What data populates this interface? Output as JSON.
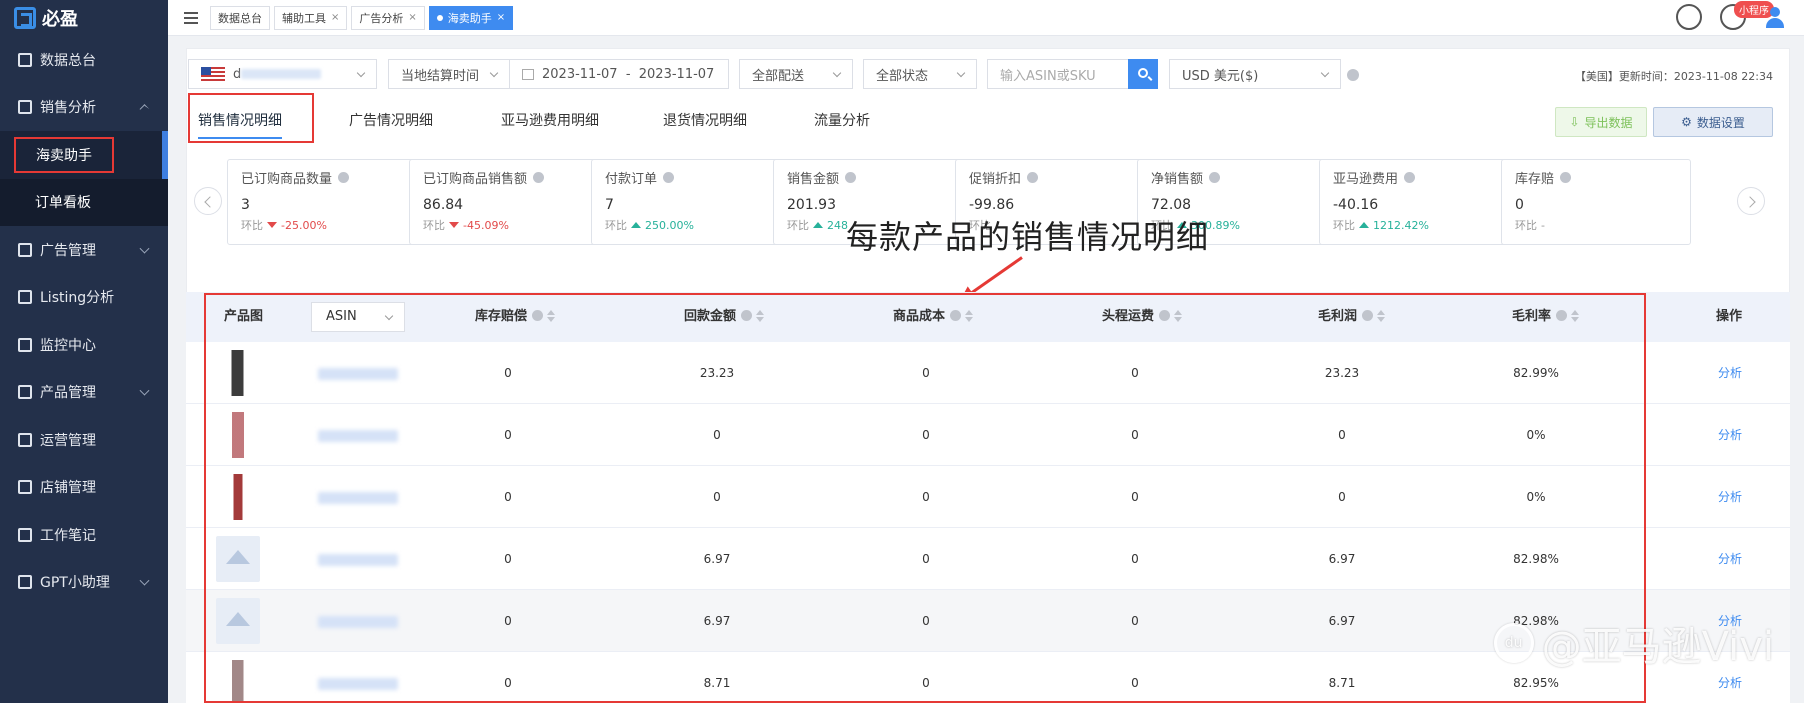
{
  "brand": {
    "name": "必盈"
  },
  "sidebar": {
    "items": [
      {
        "label": "数据总台",
        "icon": "monitor-icon"
      },
      {
        "label": "销售分析",
        "icon": "chart-icon",
        "expanded": true
      },
      {
        "label": "海卖助手",
        "sub": true,
        "active": true
      },
      {
        "label": "订单看板",
        "sub": true
      },
      {
        "label": "广告管理",
        "icon": "ad-icon"
      },
      {
        "label": "Listing分析",
        "icon": "bar-chart-icon"
      },
      {
        "label": "监控中心",
        "icon": "monitor-icon"
      },
      {
        "label": "产品管理",
        "icon": "grid-icon"
      },
      {
        "label": "运营管理",
        "icon": "user-icon"
      },
      {
        "label": "店铺管理",
        "icon": "store-icon"
      },
      {
        "label": "工作笔记",
        "icon": "note-icon"
      },
      {
        "label": "GPT小助理",
        "icon": "bot-icon"
      }
    ]
  },
  "topbar": {
    "tabs": [
      {
        "label": "数据总台"
      },
      {
        "label": "辅助工具"
      },
      {
        "label": "广告分析"
      },
      {
        "label": "海卖助手",
        "active": true
      }
    ],
    "mini_program": "小程序"
  },
  "filters": {
    "store": "d",
    "settlement": "当地结算时间",
    "date_range": "2023-11-07  -  2023-11-07",
    "shipping": "全部配送",
    "status": "全部状态",
    "asin_placeholder": "输入ASIN或SKU",
    "currency": "USD 美元($)",
    "update_info": "【美国】更新时间：2023-11-08 22:34"
  },
  "tabs": [
    {
      "label": "销售情况明细",
      "active": true
    },
    {
      "label": "广告情况明细"
    },
    {
      "label": "亚马逊费用明细"
    },
    {
      "label": "退货情况明细"
    },
    {
      "label": "流量分析"
    }
  ],
  "buttons": {
    "export": "导出数据",
    "settings": "数据设置"
  },
  "cards": [
    {
      "label": "已订购商品数量",
      "value": "3",
      "change": "-25.00%",
      "dir": "down"
    },
    {
      "label": "已订购商品销售额",
      "value": "86.84",
      "change": "-45.09%",
      "dir": "down"
    },
    {
      "label": "付款订单",
      "value": "7",
      "change": "250.00%",
      "dir": "up"
    },
    {
      "label": "销售金额",
      "value": "201.93",
      "change": "248",
      "dir": "up"
    },
    {
      "label": "促销折扣",
      "value": "-99.86",
      "change": "",
      "dir": "none"
    },
    {
      "label": "净销售额",
      "value": "72.08",
      "change": "300.89%",
      "dir": "up"
    },
    {
      "label": "亚马逊费用",
      "value": "-40.16",
      "change": "1212.42%",
      "dir": "up"
    },
    {
      "label": "库存赔",
      "value": "0",
      "change": "-",
      "dir": "none"
    }
  ],
  "change_prefix": "环比",
  "annotation": "每款产品的销售情况明细",
  "table": {
    "headers": {
      "image": "产品图",
      "asin": "ASIN",
      "compensation": "库存赔偿",
      "refund": "回款金额",
      "cost": "商品成本",
      "shipping": "头程运费",
      "profit": "毛利润",
      "margin": "毛利率",
      "action": "操作"
    },
    "rows": [
      {
        "compensation": "0",
        "refund": "23.23",
        "cost": "0",
        "shipping": "0",
        "profit": "23.23",
        "margin": "82.99%",
        "action": "分析"
      },
      {
        "compensation": "0",
        "refund": "0",
        "cost": "0",
        "shipping": "0",
        "profit": "0",
        "margin": "0%",
        "action": "分析"
      },
      {
        "compensation": "0",
        "refund": "0",
        "cost": "0",
        "shipping": "0",
        "profit": "0",
        "margin": "0%",
        "action": "分析"
      },
      {
        "compensation": "0",
        "refund": "6.97",
        "cost": "0",
        "shipping": "0",
        "profit": "6.97",
        "margin": "82.98%",
        "action": "分析"
      },
      {
        "compensation": "0",
        "refund": "6.97",
        "cost": "0",
        "shipping": "0",
        "profit": "6.97",
        "margin": "82.98%",
        "action": "分析"
      },
      {
        "compensation": "0",
        "refund": "8.71",
        "cost": "0",
        "shipping": "0",
        "profit": "8.71",
        "margin": "82.95%",
        "action": "分析"
      }
    ]
  },
  "watermark": "@亚马逊Vivi"
}
